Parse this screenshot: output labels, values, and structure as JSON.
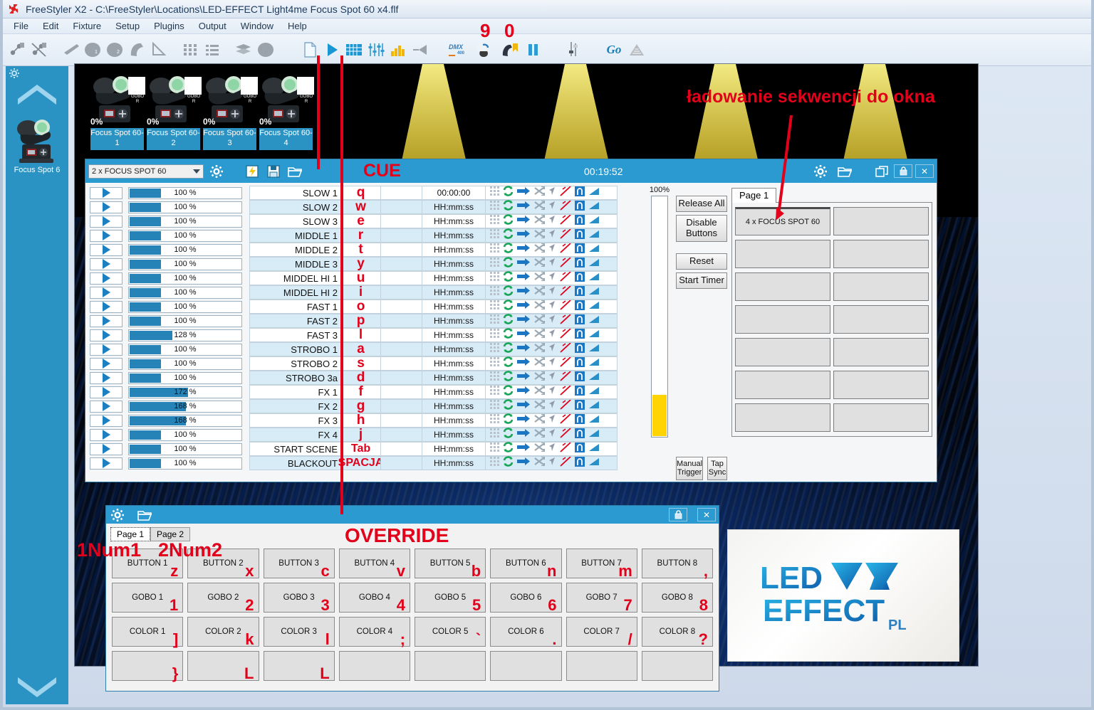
{
  "window": {
    "title": "FreeStyler X2  -  C:\\FreeStyler\\Locations\\LED-EFFECT Light4me Focus Spot 60 x4.flf",
    "app_icon": "freestyler-logo-icon"
  },
  "menu": {
    "items": [
      "File",
      "Edit",
      "Fixture",
      "Setup",
      "Plugins",
      "Output",
      "Window",
      "Help"
    ]
  },
  "toolbar": {
    "items": [
      {
        "name": "dmx-patch-icon",
        "label": ""
      },
      {
        "name": "dmx-unpatch-icon",
        "label": ""
      },
      {
        "name": "beam-icon",
        "label": ""
      },
      {
        "name": "circle-1-icon",
        "label": ""
      },
      {
        "name": "circle-2-icon",
        "label": ""
      },
      {
        "name": "moving-head-icon",
        "label": ""
      },
      {
        "name": "cone-icon",
        "label": ""
      },
      {
        "name": "grid-view-icon",
        "label": ""
      },
      {
        "name": "list-view-icon",
        "label": ""
      },
      {
        "name": "group-copy-icon",
        "label": ""
      },
      {
        "name": "ellipse-fixture-icon",
        "label": ""
      },
      {
        "name": "new-scene-icon",
        "label": ""
      },
      {
        "name": "play-sequence-icon",
        "label": ""
      },
      {
        "name": "cuelist-grid-icon",
        "label": ""
      },
      {
        "name": "faders-icon",
        "label": ""
      },
      {
        "name": "submaster-icon",
        "label": ""
      },
      {
        "name": "beam-preview-icon",
        "label": ""
      },
      {
        "name": "dmx400-icon",
        "label": "DMX 400"
      },
      {
        "name": "fixture-control-icon",
        "label": ""
      },
      {
        "name": "bookmark-fixture-icon",
        "label": ""
      },
      {
        "name": "pause-icon",
        "label": ""
      },
      {
        "name": "single-fader-icon",
        "label": ""
      },
      {
        "name": "go-button",
        "label": "Go"
      },
      {
        "name": "fade-icon",
        "label": ""
      }
    ],
    "go_label": "Go",
    "dmx_label": "DMX",
    "dmx_sub": "400"
  },
  "sidebar": {
    "gear_icon": "gear-icon",
    "chevron_up_icon": "chevron-up-icon",
    "chevron_down_icon": "chevron-down-icon",
    "fixture_label": "Focus Spot 6"
  },
  "stage": {
    "fixtures": [
      {
        "name": "Focus Spot 60-1",
        "percent": "0%",
        "gobo_label": "GOBO\nR"
      },
      {
        "name": "Focus Spot 60-2",
        "percent": "0%",
        "gobo_label": "GOBO\nR"
      },
      {
        "name": "Focus Spot 60-3",
        "percent": "0%",
        "gobo_label": "GOBO\nR"
      },
      {
        "name": "Focus Spot 60-4",
        "percent": "0%",
        "gobo_label": "GOBO\nR"
      }
    ],
    "fixture_name_prefix": "Focus Spot",
    "annotation_top": "ładowanie sekwencji do okna"
  },
  "cue_window": {
    "selector_value": "2 x FOCUS SPOT 60",
    "title_annotation": "CUE",
    "timer": "00:19:52",
    "header_icons": [
      "gear-icon",
      "import-sequence-icon",
      "save-icon",
      "open-folder-icon",
      "gear-icon",
      "open-folder-icon",
      "restore-icon",
      "lock-icon",
      "close-icon"
    ],
    "lock_glyph": "🔒",
    "close_glyph": "✕",
    "rows": [
      {
        "name": "SLOW 1",
        "percent": "100 %",
        "bar": 28,
        "key": "q",
        "time": "00:00:00"
      },
      {
        "name": "SLOW 2",
        "percent": "100 %",
        "bar": 28,
        "key": "w",
        "time": "HH:mm:ss"
      },
      {
        "name": "SLOW 3",
        "percent": "100 %",
        "bar": 28,
        "key": "e",
        "time": "HH:mm:ss"
      },
      {
        "name": "MIDDLE 1",
        "percent": "100 %",
        "bar": 28,
        "key": "r",
        "time": "HH:mm:ss"
      },
      {
        "name": "MIDDLE 2",
        "percent": "100 %",
        "bar": 28,
        "key": "t",
        "time": "HH:mm:ss"
      },
      {
        "name": "MIDDLE 3",
        "percent": "100 %",
        "bar": 28,
        "key": "y",
        "time": "HH:mm:ss"
      },
      {
        "name": "MIDDEL HI 1",
        "percent": "100 %",
        "bar": 28,
        "key": "u",
        "time": "HH:mm:ss"
      },
      {
        "name": "MIDDEL HI 2",
        "percent": "100 %",
        "bar": 28,
        "key": "i",
        "time": "HH:mm:ss"
      },
      {
        "name": "FAST 1",
        "percent": "100 %",
        "bar": 28,
        "key": "o",
        "time": "HH:mm:ss"
      },
      {
        "name": "FAST 2",
        "percent": "100 %",
        "bar": 28,
        "key": "p",
        "time": "HH:mm:ss"
      },
      {
        "name": "FAST 3",
        "percent": "128 %",
        "bar": 38,
        "key": "l",
        "time": "HH:mm:ss"
      },
      {
        "name": "STROBO 1",
        "percent": "100 %",
        "bar": 28,
        "key": "a",
        "time": "HH:mm:ss"
      },
      {
        "name": "STROBO 2",
        "percent": "100 %",
        "bar": 28,
        "key": "s",
        "time": "HH:mm:ss"
      },
      {
        "name": "STROBO 3a",
        "percent": "100 %",
        "bar": 28,
        "key": "d",
        "time": "HH:mm:ss"
      },
      {
        "name": "FX 1",
        "percent": "172 %",
        "bar": 52,
        "key": "f",
        "time": "HH:mm:ss"
      },
      {
        "name": "FX 2",
        "percent": "168 %",
        "bar": 50,
        "key": "g",
        "time": "HH:mm:ss"
      },
      {
        "name": "FX 3",
        "percent": "168 %",
        "bar": 50,
        "key": "h",
        "time": "HH:mm:ss"
      },
      {
        "name": "FX 4",
        "percent": "100 %",
        "bar": 28,
        "key": "j",
        "time": "HH:mm:ss"
      },
      {
        "name": "START SCENE",
        "percent": "100 %",
        "bar": 28,
        "key": "Tab",
        "time": "HH:mm:ss"
      },
      {
        "name": "BLACKOUT",
        "percent": "100 %",
        "bar": 28,
        "key": "SPACJA",
        "time": "HH:mm:ss"
      }
    ],
    "row_icons": [
      "drag-handle-icon",
      "loop-icon",
      "forward-arrow-icon",
      "shuffle-icon",
      "cursor-icon",
      "no-fade-icon",
      "gate-icon",
      "fade-ramp-icon"
    ],
    "fader": {
      "label": "100%",
      "value": 100
    },
    "buttons": {
      "release_all": "Release All",
      "disable_buttons": "Disable Buttons",
      "reset": "Reset",
      "start_timer": "Start Timer",
      "manual_trigger": "Manual Trigger",
      "tap_sync": "Tap Sync"
    },
    "page_tab": "Page 1",
    "page_buttons": [
      "4 x FOCUS SPOT 60",
      "",
      "",
      "",
      "",
      "",
      "",
      "",
      "",
      "",
      "",
      "",
      "",
      ""
    ]
  },
  "override_window": {
    "title_annotation": "OVERRIDE",
    "header_icons": [
      "gear-icon",
      "open-folder-icon",
      "lock-icon",
      "close-icon"
    ],
    "lock_glyph": "🔒",
    "close_glyph": "✕",
    "tabs": [
      {
        "label": "Page 1",
        "selected": true,
        "key": "1Num1"
      },
      {
        "label": "Page 2",
        "selected": false,
        "key": "2Num2"
      }
    ],
    "buttons": [
      {
        "label": "BUTTON 1",
        "key": "z"
      },
      {
        "label": "BUTTON 2",
        "key": "x"
      },
      {
        "label": "BUTTON 3",
        "key": "c"
      },
      {
        "label": "BUTTON 4",
        "key": "v"
      },
      {
        "label": "BUTTON 5",
        "key": "b"
      },
      {
        "label": "BUTTON 6",
        "key": "n"
      },
      {
        "label": "BUTTON 7",
        "key": "m"
      },
      {
        "label": "BUTTON 8",
        "key": ","
      },
      {
        "label": "GOBO 1",
        "key": "1"
      },
      {
        "label": "GOBO 2",
        "key": "2"
      },
      {
        "label": "GOBO 3",
        "key": "3"
      },
      {
        "label": "GOBO 4",
        "key": "4"
      },
      {
        "label": "GOBO 5",
        "key": "5"
      },
      {
        "label": "GOBO 6",
        "key": "6"
      },
      {
        "label": "GOBO 7",
        "key": "7"
      },
      {
        "label": "GOBO 8",
        "key": "8"
      },
      {
        "label": "COLOR 1",
        "key": "]"
      },
      {
        "label": "COLOR 2",
        "key": "k"
      },
      {
        "label": "COLOR 3",
        "key": "l"
      },
      {
        "label": "COLOR 4",
        "key": ";"
      },
      {
        "label": "COLOR 5",
        "key": "`"
      },
      {
        "label": "COLOR 6",
        "key": "."
      },
      {
        "label": "COLOR 7",
        "key": "/"
      },
      {
        "label": "COLOR 8",
        "key": "?"
      },
      {
        "label": "",
        "key": "}"
      },
      {
        "label": "",
        "key": "L"
      },
      {
        "label": "",
        "key": "L"
      },
      {
        "label": "",
        "key": ""
      },
      {
        "label": "",
        "key": ""
      },
      {
        "label": "",
        "key": ""
      },
      {
        "label": "",
        "key": ""
      },
      {
        "label": "",
        "key": ""
      }
    ]
  },
  "logo": {
    "line1": "LED",
    "line2": "EFFECT",
    "suffix": "PL"
  },
  "annotations": {
    "toolbar_key_9": "9",
    "toolbar_key_0": "0",
    "load_sequence": "ładowanie sekwencji do okna",
    "cue": "CUE",
    "override": "OVERRIDE"
  },
  "colors": {
    "accent_blue": "#2a9ad0",
    "sidebar_blue": "#2a93c3",
    "annotation_red": "#e2001a",
    "bar_blue": "#2583b8",
    "fader_yellow": "#ffd400"
  }
}
